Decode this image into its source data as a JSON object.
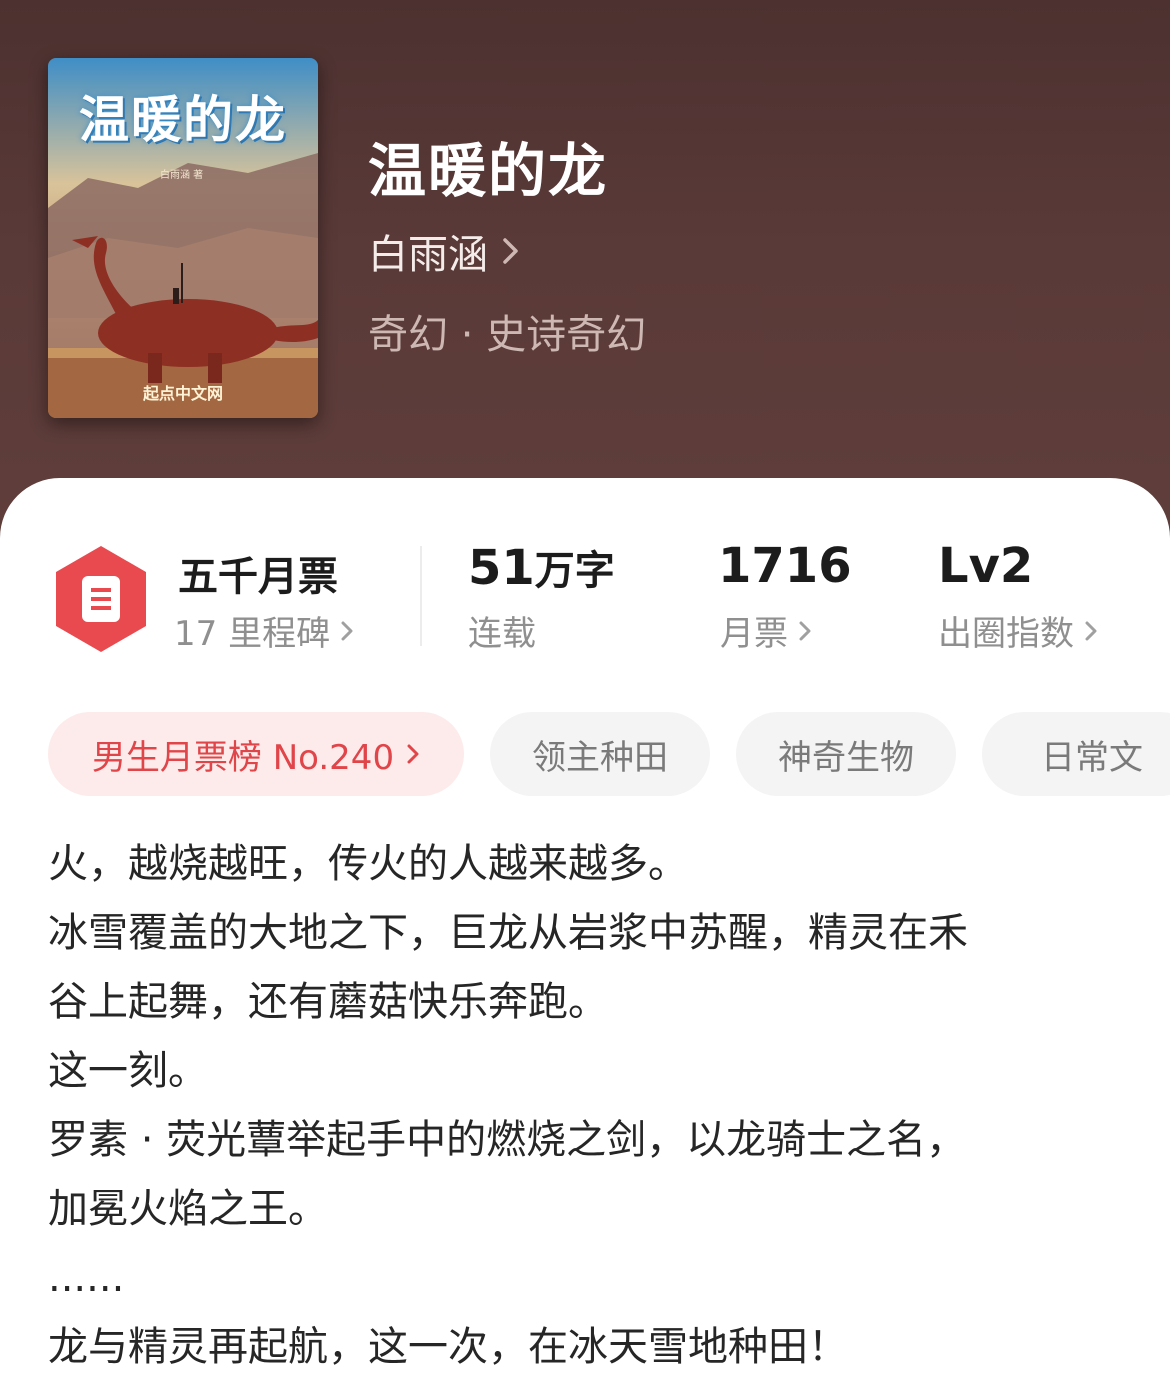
{
  "book": {
    "title": "温暖的龙",
    "author": "白雨涵",
    "genre": "奇幻 · 史诗奇幻",
    "cover": {
      "title": "温暖的龙",
      "author_line": "白雨涵 著",
      "publisher": "起点中文网"
    }
  },
  "stats": {
    "badge": {
      "icon": "ticket-icon",
      "title": "五千月票",
      "subtitle": "17 里程碑"
    },
    "words": {
      "value": "51",
      "unit": "万字",
      "label": "连载"
    },
    "monthly_tickets": {
      "value": "1716",
      "label": "月票"
    },
    "influence": {
      "value": "Lv2",
      "label": "出圈指数"
    }
  },
  "tags": [
    {
      "label": "男生月票榜 No.240",
      "type": "rank"
    },
    {
      "label": "领主种田",
      "type": "plain"
    },
    {
      "label": "神奇生物",
      "type": "plain"
    },
    {
      "label": "日常文",
      "type": "plain"
    }
  ],
  "description": [
    "火，越烧越旺，传火的人越来越多。",
    "冰雪覆盖的大地之下，巨龙从岩浆中苏醒，精灵在禾",
    "谷上起舞，还有蘑菇快乐奔跑。",
    "这一刻。",
    "罗素 · 荧光蕈举起手中的燃烧之剑，以龙骑士之名，",
    "加冕火焰之王。",
    "......",
    "龙与精灵再起航，这一次，在冰天雪地种田！"
  ],
  "colors": {
    "header_bg": "#5a3a38",
    "accent_red": "#e0454a",
    "rank_tag_bg": "#fdebeb"
  }
}
